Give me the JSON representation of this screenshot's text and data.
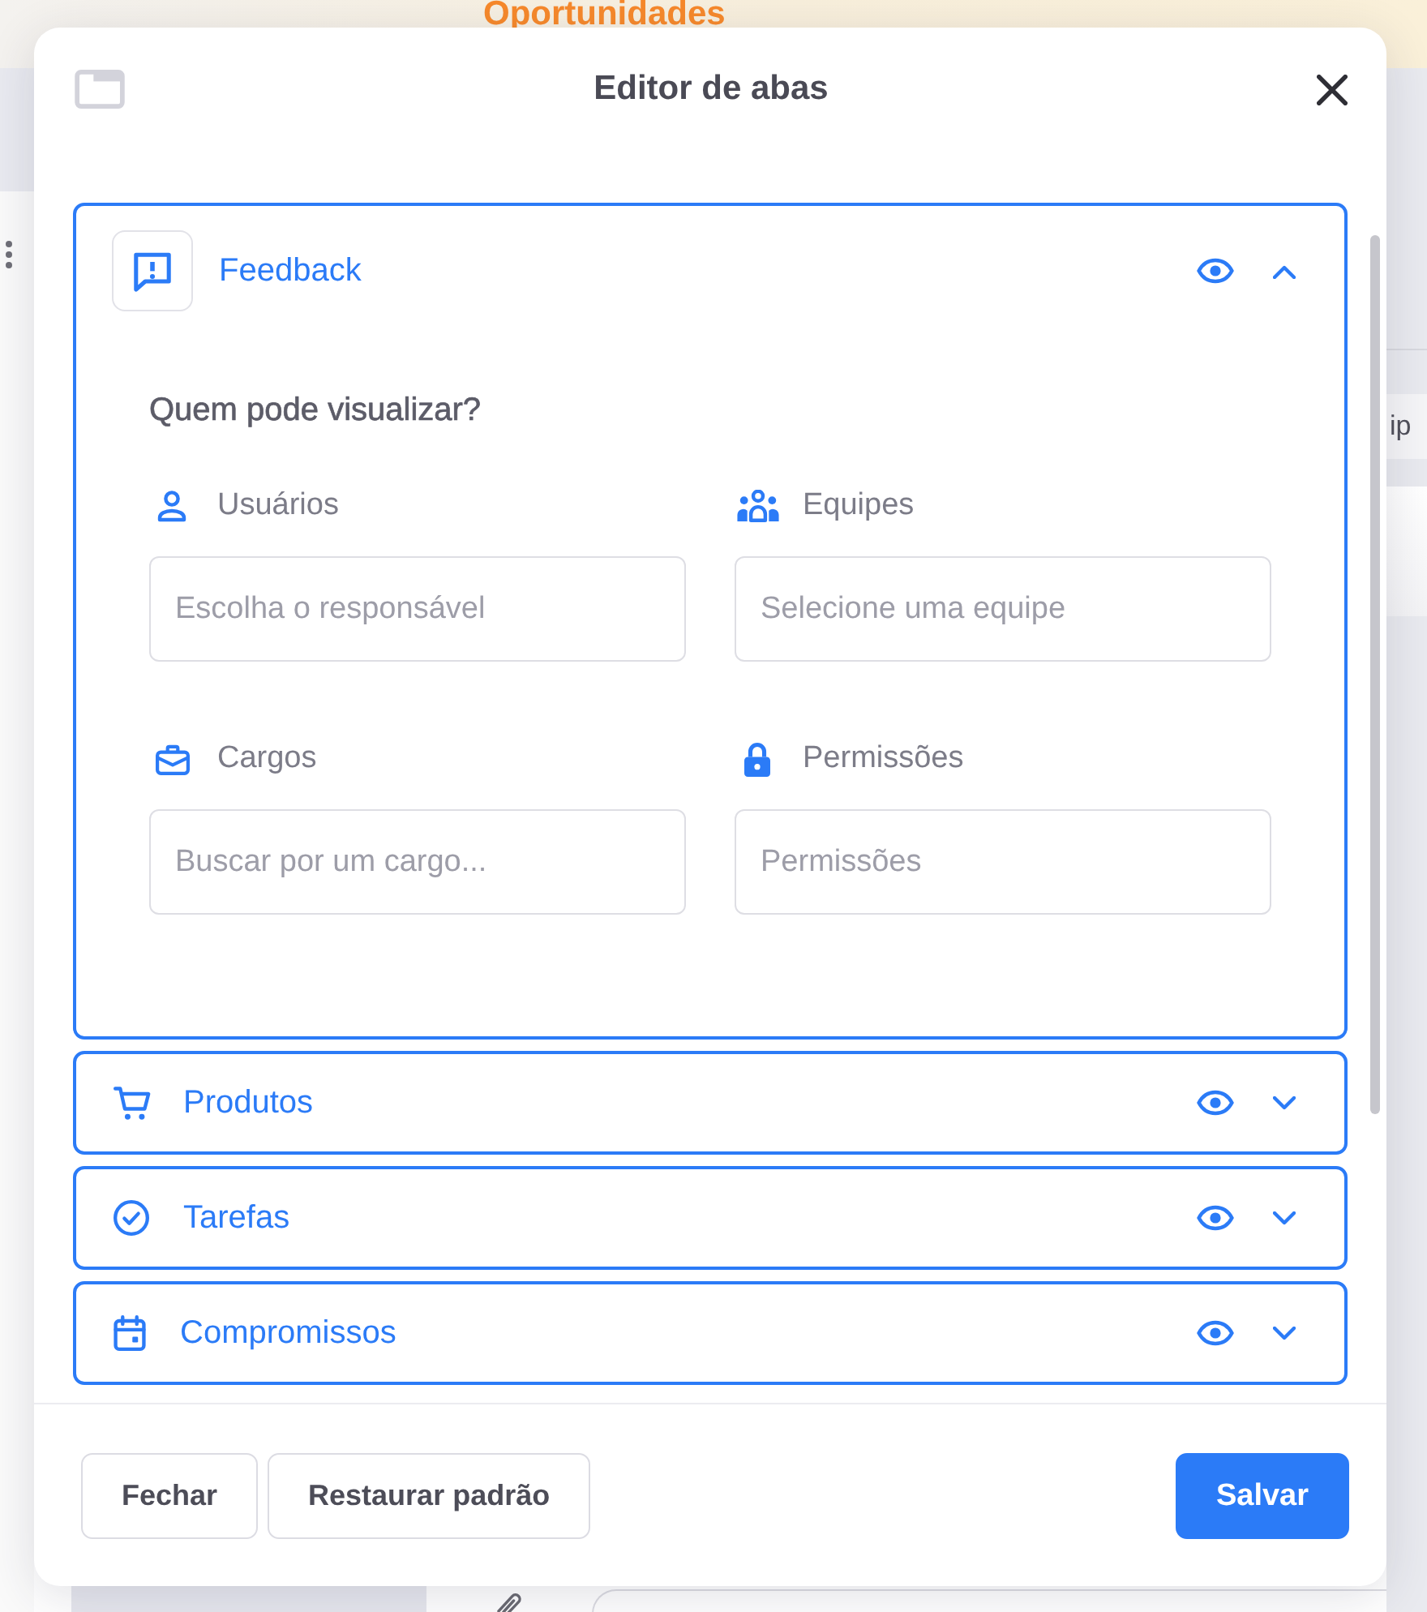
{
  "background": {
    "page_title": "Oportunidades",
    "side_field": {
      "value": "ip"
    }
  },
  "dialog": {
    "title": "Editor de abas",
    "tabs": [
      {
        "kind": "feedback",
        "label": "Feedback",
        "visible": true,
        "expanded": true,
        "access": {
          "title": "Quem pode visualizar?",
          "fields": [
            {
              "kind": "user",
              "label": "Usuários",
              "placeholder": "Escolha o responsável"
            },
            {
              "kind": "team",
              "label": "Equipes",
              "placeholder": "Selecione uma equipe"
            },
            {
              "kind": "role",
              "label": "Cargos",
              "placeholder": "Buscar por um cargo..."
            },
            {
              "kind": "permission",
              "label": "Permissões",
              "placeholder": "Permissões"
            }
          ]
        }
      },
      {
        "kind": "products",
        "label": "Produtos",
        "visible": true,
        "expanded": false
      },
      {
        "kind": "tasks",
        "label": "Tarefas",
        "visible": true,
        "expanded": false
      },
      {
        "kind": "appointments",
        "label": "Compromissos",
        "visible": true,
        "expanded": false
      }
    ],
    "buttons": [
      {
        "kind": "secondary",
        "label": "Fechar"
      },
      {
        "kind": "secondary",
        "label": "Restaurar padrão"
      },
      {
        "kind": "primary",
        "label": "Salvar"
      }
    ]
  }
}
